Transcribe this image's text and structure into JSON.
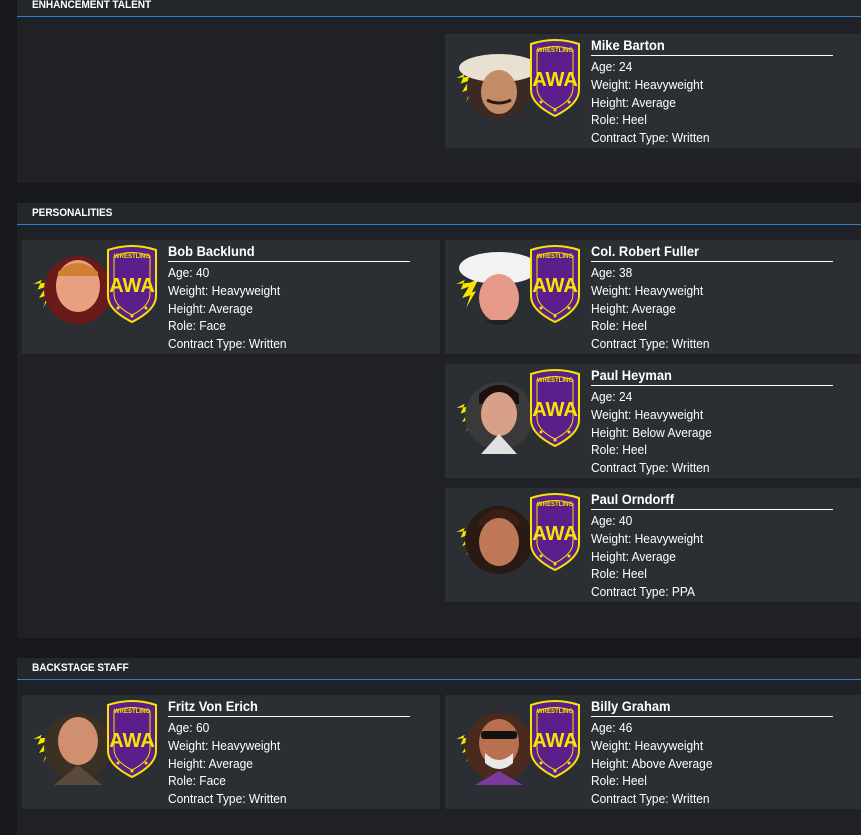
{
  "sections": [
    {
      "title": "Enhancement Talent"
    },
    {
      "title": "Personalities"
    },
    {
      "title": "Backstage Staff"
    }
  ],
  "labels": {
    "age": "Age:",
    "weight": "Weight:",
    "height": "Height:",
    "role": "Role:",
    "contract": "Contract Type:"
  },
  "logo_text": "AMERICAN WRESTLING ASSOCIATION",
  "logo_initials": "AWA",
  "colors": {
    "page_bg": "#16181b",
    "section_bg": "#1f2126",
    "card_bg": "#2b2e33",
    "accent_line": "#2f7fd1",
    "logo_purple": "#5b1e8a",
    "logo_yellow": "#f5e600"
  },
  "workers": {
    "mike_barton": {
      "name": "Mike Barton",
      "age": "24",
      "weight": "Heavyweight",
      "height": "Average",
      "role": "Heel",
      "contract": "Written"
    },
    "bob_backlund": {
      "name": "Bob Backlund",
      "age": "40",
      "weight": "Heavyweight",
      "height": "Average",
      "role": "Face",
      "contract": "Written"
    },
    "robert_fuller": {
      "name": "Col. Robert Fuller",
      "age": "38",
      "weight": "Heavyweight",
      "height": "Average",
      "role": "Heel",
      "contract": "Written"
    },
    "paul_heyman": {
      "name": "Paul Heyman",
      "age": "24",
      "weight": "Heavyweight",
      "height": "Below Average",
      "role": "Heel",
      "contract": "Written"
    },
    "paul_orndorff": {
      "name": "Paul Orndorff",
      "age": "40",
      "weight": "Heavyweight",
      "height": "Average",
      "role": "Heel",
      "contract": "PPA"
    },
    "fritz_von_erich": {
      "name": "Fritz Von Erich",
      "age": "60",
      "weight": "Heavyweight",
      "height": "Average",
      "role": "Face",
      "contract": "Written"
    },
    "billy_graham": {
      "name": "Billy Graham",
      "age": "46",
      "weight": "Heavyweight",
      "height": "Above Average",
      "role": "Heel",
      "contract": "Written"
    }
  }
}
